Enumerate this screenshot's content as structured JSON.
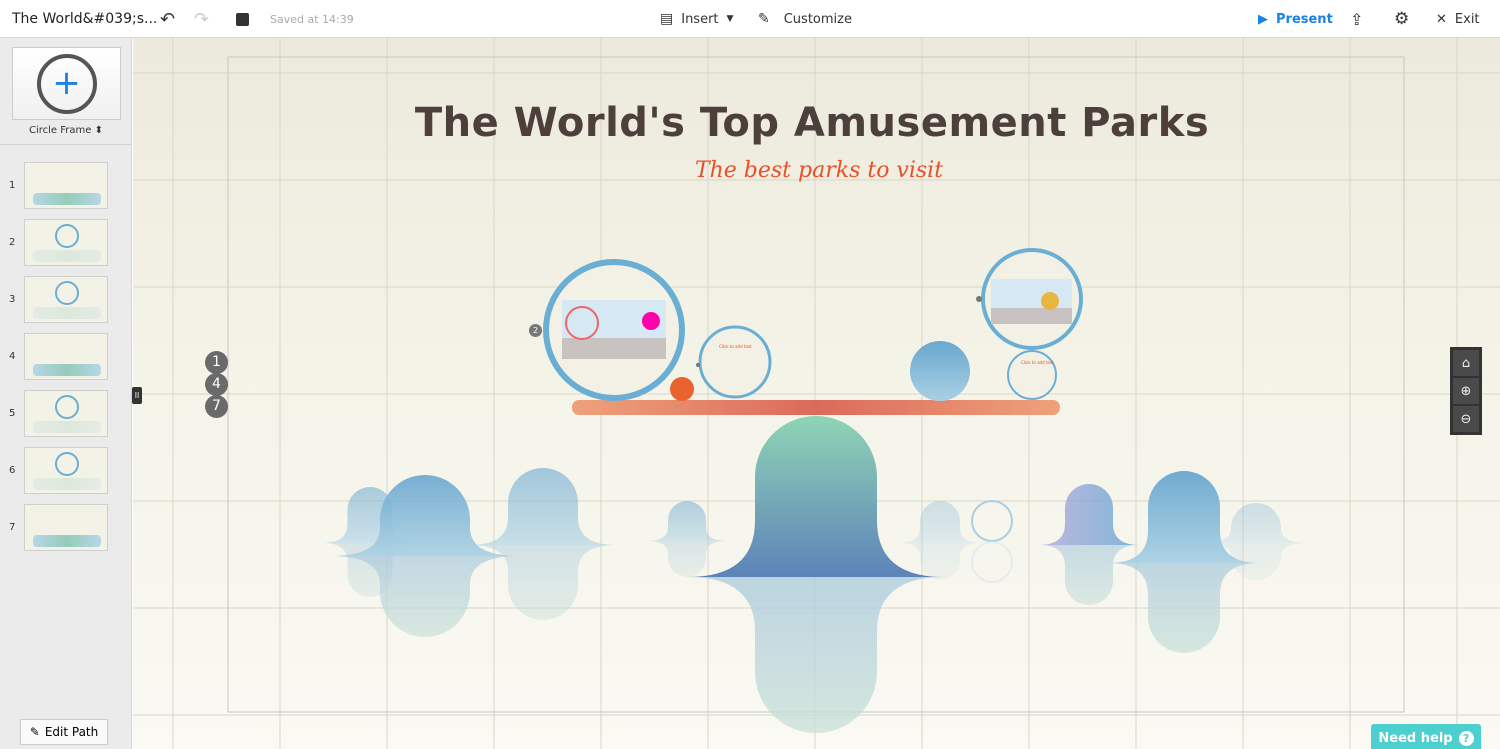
{
  "topbar": {
    "title": "The World&#039;s...",
    "saved": "Saved at 14:39",
    "insert": "Insert",
    "customize": "Customize",
    "present": "Present",
    "exit": "Exit"
  },
  "sidebar": {
    "frame_type": "Circle Frame",
    "edit_path": "Edit Path",
    "slides": [
      "1",
      "2",
      "3",
      "4",
      "5",
      "6",
      "7"
    ]
  },
  "canvas": {
    "title": "The World's Top Amusement Parks",
    "subtitle": "The best parks to visit",
    "add_text": "Click to add text",
    "path_numbers": [
      "1",
      "4",
      "7"
    ],
    "path_marker": "2"
  },
  "help": {
    "label": "Need help",
    "icon": "?"
  },
  "colors": {
    "accent": "#1a82e2",
    "title": "#4d3f3c",
    "subtitle": "#e8502a",
    "help": "#4bcfcf",
    "frame": "#6aaed4"
  }
}
